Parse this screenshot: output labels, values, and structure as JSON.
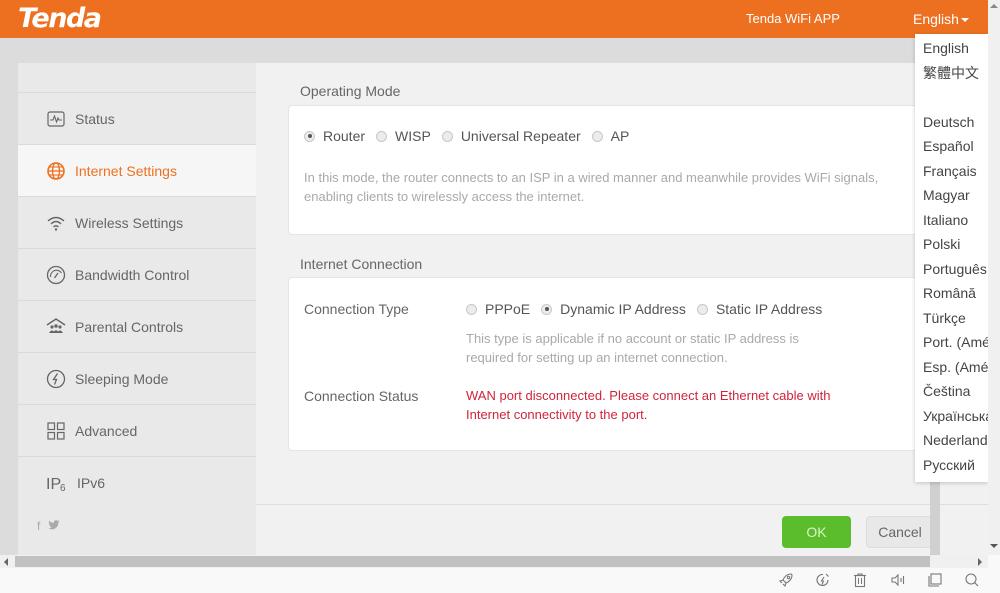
{
  "header": {
    "logo": "Tenda",
    "app_link": "Tenda WiFi APP",
    "language_selected": "English"
  },
  "colors": {
    "brand_orange": "#ed7020",
    "ok_green": "#5bbd2b",
    "error_red": "#d0243c"
  },
  "sidebar": {
    "items": [
      {
        "label": "Status",
        "icon": "status-monitor-icon",
        "active": false
      },
      {
        "label": "Internet Settings",
        "icon": "globe-icon",
        "active": true
      },
      {
        "label": "Wireless Settings",
        "icon": "wifi-icon",
        "active": false
      },
      {
        "label": "Bandwidth Control",
        "icon": "speedometer-icon",
        "active": false
      },
      {
        "label": "Parental Controls",
        "icon": "family-house-icon",
        "active": false
      },
      {
        "label": "Sleeping Mode",
        "icon": "power-bolt-icon",
        "active": false
      },
      {
        "label": "Advanced",
        "icon": "grid-icon",
        "active": false
      },
      {
        "label": "IPv6",
        "icon": "ipv6-icon",
        "active": false
      }
    ],
    "social": [
      "f",
      "twitter"
    ]
  },
  "operating_mode": {
    "title": "Operating Mode",
    "options": [
      {
        "label": "Router",
        "checked": true
      },
      {
        "label": "WISP",
        "checked": false
      },
      {
        "label": "Universal Repeater",
        "checked": false
      },
      {
        "label": "AP",
        "checked": false
      }
    ],
    "description_line1": "In this mode, the router connects to an ISP in a wired manner and meanwhile provides WiFi signals,",
    "description_line2": "enabling clients to wirelessly access the internet."
  },
  "internet_connection": {
    "title": "Internet Connection",
    "connection_type_label": "Connection Type",
    "options": [
      {
        "label": "PPPoE",
        "checked": false
      },
      {
        "label": "Dynamic IP Address",
        "checked": true
      },
      {
        "label": "Static IP Address",
        "checked": false
      }
    ],
    "type_desc_line1": "This type is applicable if no account or static IP address is",
    "type_desc_line2": "required for setting up an internet connection.",
    "connection_status_label": "Connection Status",
    "status_line1": "WAN port disconnected. Please connect an Ethernet cable with",
    "status_line2": "Internet connectivity to the port."
  },
  "buttons": {
    "ok": "OK",
    "cancel": "Cancel"
  },
  "language_menu": {
    "items": [
      "English",
      "繁體中文",
      "",
      "Deutsch",
      "Español",
      "Français",
      "Magyar",
      "Italiano",
      "Polski",
      "Português",
      "Română",
      "Türkçe",
      "Port. (América)",
      "Esp. (América)",
      "Čeština",
      "Українська",
      "Nederlands",
      "Русский"
    ]
  }
}
